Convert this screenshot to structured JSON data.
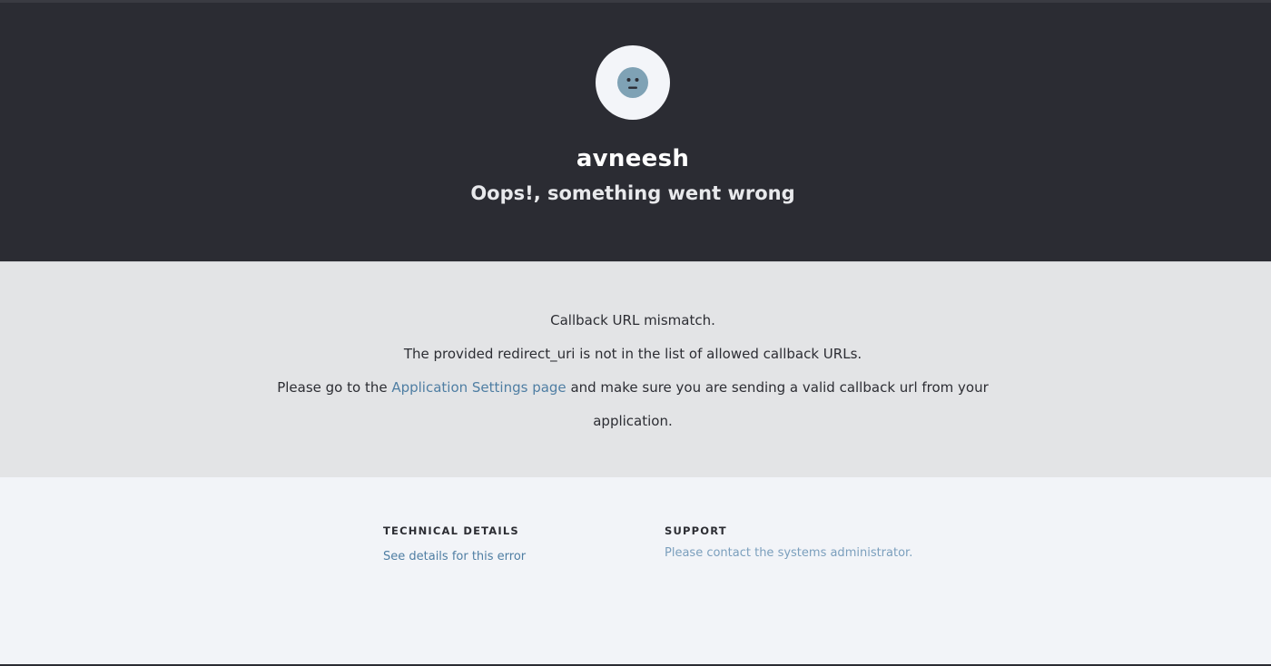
{
  "header": {
    "avatar_icon": "sad-face-icon",
    "app_name": "avneesh",
    "subtitle": "Oops!, something went wrong"
  },
  "message": {
    "line1": "Callback URL mismatch.",
    "line2": "The provided redirect_uri is not in the list of allowed callback URLs.",
    "line3_prefix": "Please go to the ",
    "line3_link": "Application Settings page",
    "line3_suffix": " and make sure you are sending a valid callback url from your",
    "line4": "application."
  },
  "footer": {
    "technical": {
      "title": "TECHNICAL DETAILS",
      "link": "See details for this error"
    },
    "support": {
      "title": "SUPPORT",
      "text": "Please contact the systems administrator."
    }
  },
  "colors": {
    "header_bg": "#2b2c33",
    "message_bg": "#e3e4e6",
    "footer_bg": "#f2f4f8",
    "link": "#4f7ea3",
    "icon_face": "#7fa2b5"
  }
}
